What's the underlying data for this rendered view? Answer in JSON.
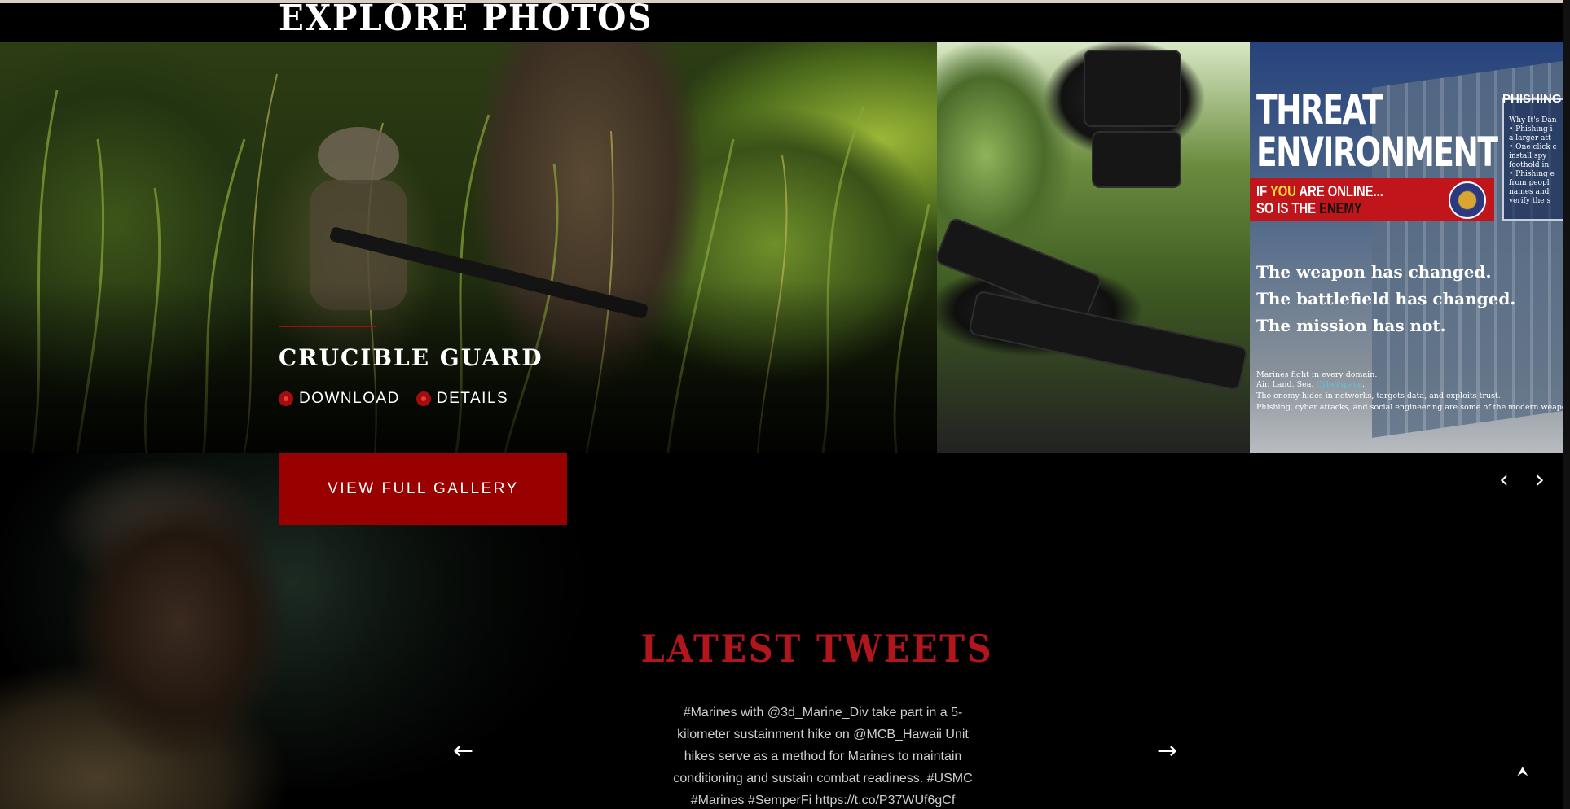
{
  "photos": {
    "section_title": "EXPLORE PHOTOS",
    "featured": {
      "title": "CRUCIBLE GUARD",
      "download_label": "DOWNLOAD",
      "details_label": "DETAILS"
    },
    "graphic": {
      "headline_1": "THREAT",
      "headline_2": "ENVIRONMENT",
      "band_1_a": "IF ",
      "band_1_b": "YOU",
      "band_1_c": " ARE ONLINE...",
      "band_2_a": "SO IS THE ",
      "band_2_b": "ENEMY",
      "phishing_head": "PHISHING",
      "phishing_lines": [
        "Why It's Dan",
        "• Phishing i",
        "  a larger att",
        "• One click c",
        "  install spy",
        "  foothold in",
        "• Phishing e",
        "  from peopl",
        "  names and",
        "  verify the s"
      ],
      "weapon_1": "The weapon has changed.",
      "weapon_2": "The battlefield has changed.",
      "weapon_3": "The mission has not.",
      "small_1": "Marines fight in every domain.",
      "small_2a": "Air. Land. Sea. ",
      "small_2b": "Cyberspace",
      "small_2c": ".",
      "small_3": "The enemy hides in networks, targets data, and exploits trust.",
      "small_4": "Phishing, cyber attacks, and social engineering are some of the modern weapo"
    },
    "view_gallery_label": "VIEW FULL GALLERY",
    "prev_icon": "‹",
    "next_icon": "›"
  },
  "tweets": {
    "title": "LATEST TWEETS",
    "text": "#Marines with @3d_Marine_Div take part in a 5-kilometer sustainment hike on @MCB_Hawaii Unit hikes serve as a method for Marines to maintain conditioning and sustain combat readiness. #USMC #Marines #SemperFi https://t.co/P37WUf6gCf",
    "prev_icon": "←",
    "next_icon": "→"
  },
  "scroll_top_icon": "⮝",
  "colors": {
    "accent": "#990000",
    "title_red": "#b0161b"
  }
}
